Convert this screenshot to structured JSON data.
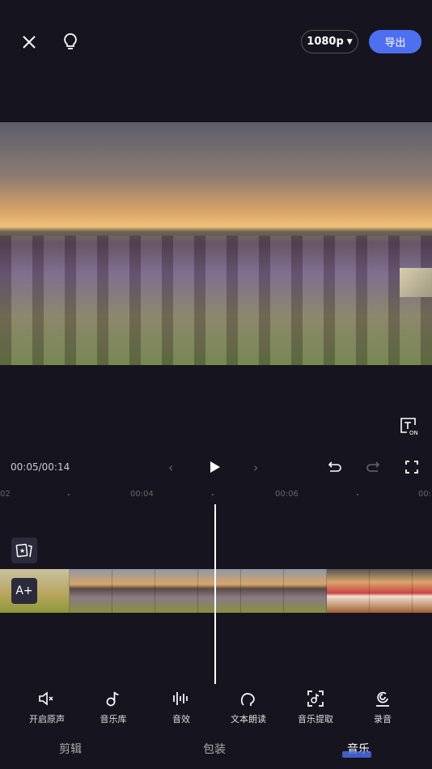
{
  "header": {
    "resolution": "1080p",
    "export_label": "导出"
  },
  "player": {
    "time": "00:05/00:14"
  },
  "ruler": [
    "02",
    "00:04",
    "00:06",
    "00:"
  ],
  "timeline": {
    "add_text_label": "A+"
  },
  "tools": [
    {
      "label": "开启原声",
      "icon": "speaker-mute-icon"
    },
    {
      "label": "音乐库",
      "icon": "music-note-icon"
    },
    {
      "label": "音效",
      "icon": "waveform-icon"
    },
    {
      "label": "文本朗读",
      "icon": "text-to-speech-icon"
    },
    {
      "label": "音乐提取",
      "icon": "music-extract-icon"
    },
    {
      "label": "录音",
      "icon": "microphone-icon"
    }
  ],
  "tabs": [
    {
      "label": "剪辑"
    },
    {
      "label": "包装"
    },
    {
      "label": "音乐",
      "active": true
    }
  ],
  "colors": {
    "accent": "#4e6ff0",
    "background": "#16151f"
  }
}
